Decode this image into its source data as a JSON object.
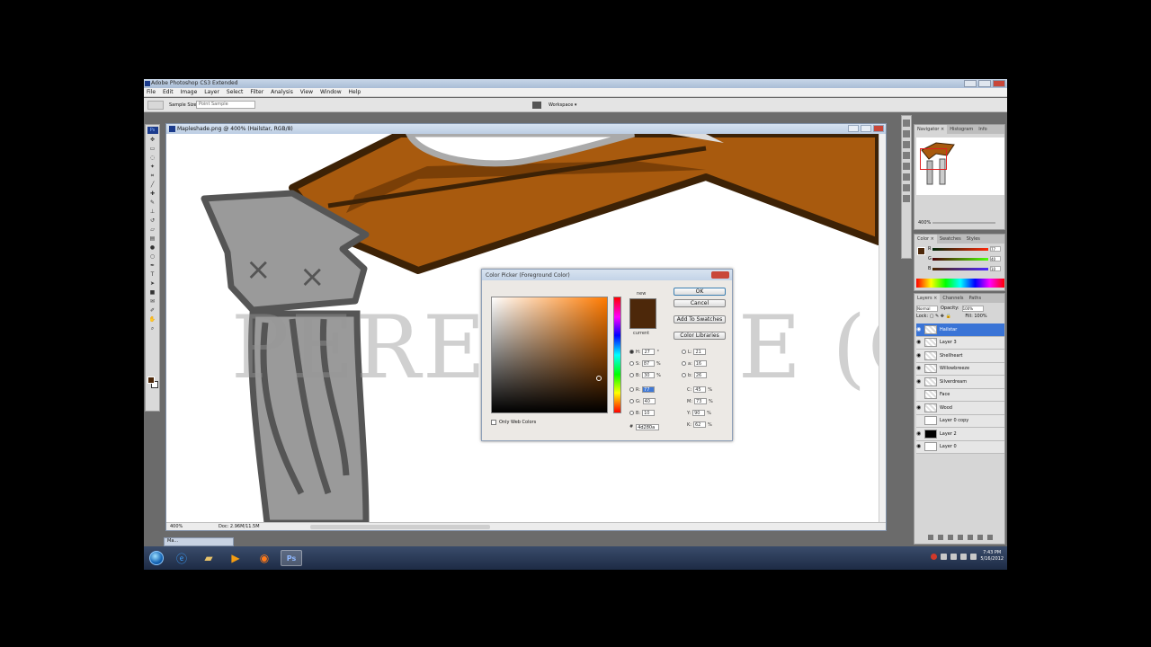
{
  "window": {
    "title": "Adobe Photoshop CS3 Extended"
  },
  "menu": [
    "File",
    "Edit",
    "Image",
    "Layer",
    "Select",
    "Filter",
    "Analysis",
    "View",
    "Window",
    "Help"
  ],
  "options_bar": {
    "sample_size_label": "Sample Size:",
    "sample_size_value": "Point Sample",
    "workspace_label": "Workspace ▾"
  },
  "document": {
    "title": "Mapleshade.png @ 400% (Hailstar, RGB/8)",
    "zoom": "400%",
    "doc_size": "Doc: 2.96M/11.5M",
    "watermark": "PEREGRINE (C)"
  },
  "color_picker": {
    "title": "Color Picker (Foreground Color)",
    "new_label": "new",
    "current_label": "current",
    "ok_label": "OK",
    "cancel_label": "Cancel",
    "add_to_swatches_label": "Add To Swatches",
    "color_libraries_label": "Color Libraries",
    "only_web_colors_label": "Only Web Colors",
    "color_hex": "#4d280a",
    "hsb": {
      "h": "27",
      "s": "87",
      "b": "30"
    },
    "rgb": {
      "r": "77",
      "g": "40",
      "b": "10"
    },
    "lab": {
      "l": "21",
      "a": "16",
      "b": "26"
    },
    "cmyk": {
      "c": "45",
      "m": "73",
      "y": "90",
      "k": "62"
    },
    "hex": "4d280a",
    "h_label": "H:",
    "s_label": "S:",
    "b_label": "B:",
    "r_label": "R:",
    "g_label": "G:",
    "bb_label": "B:",
    "l_label": "L:",
    "a_label": "a:",
    "lb_label": "b:",
    "c_label": "C:",
    "m_label": "M:",
    "y_label": "Y:",
    "k_label": "K:",
    "deg": "°",
    "pct": "%",
    "hash": "#"
  },
  "navigator_panel": {
    "tabs": [
      "Navigator ×",
      "Histogram",
      "Info"
    ],
    "zoom": "400%"
  },
  "color_panel": {
    "tabs": [
      "Color ×",
      "Swatches",
      "Styles"
    ],
    "r_label": "R",
    "g_label": "G",
    "b_label": "B",
    "r": "77",
    "g": "40",
    "b": "10"
  },
  "layers_panel": {
    "tabs": [
      "Layers ×",
      "Channels",
      "Paths"
    ],
    "blend_mode": "Normal",
    "opacity_label": "Opacity:",
    "opacity": "100%",
    "lock_label": "Lock:",
    "fill_label": "Fill:",
    "fill": "100%",
    "layers": [
      {
        "name": "Hailstar",
        "visible": true,
        "active": true,
        "thumb": "transparent"
      },
      {
        "name": "Layer 3",
        "visible": true,
        "active": false,
        "thumb": "transparent"
      },
      {
        "name": "Shellheart",
        "visible": true,
        "active": false,
        "thumb": "transparent"
      },
      {
        "name": "Willowbreeze",
        "visible": true,
        "active": false,
        "thumb": "transparent"
      },
      {
        "name": "Silverdream",
        "visible": true,
        "active": false,
        "thumb": "transparent"
      },
      {
        "name": "Face",
        "visible": false,
        "active": false,
        "thumb": "transparent"
      },
      {
        "name": "Wood",
        "visible": true,
        "active": false,
        "thumb": "transparent"
      },
      {
        "name": "Layer 0 copy",
        "visible": false,
        "active": false,
        "thumb": "white"
      },
      {
        "name": "Layer 2",
        "visible": true,
        "active": false,
        "thumb": "black"
      },
      {
        "name": "Layer 0",
        "visible": true,
        "active": false,
        "thumb": "white"
      }
    ]
  },
  "taskbar": {
    "open_window": "Ma...",
    "apps": [
      "start-orb",
      "internet-explorer-icon",
      "folder-icon",
      "media-player-icon",
      "firefox-icon",
      "photoshop-icon"
    ],
    "clock_time": "7:43 PM",
    "clock_date": "5/16/2012",
    "ps_label": "Ps"
  }
}
